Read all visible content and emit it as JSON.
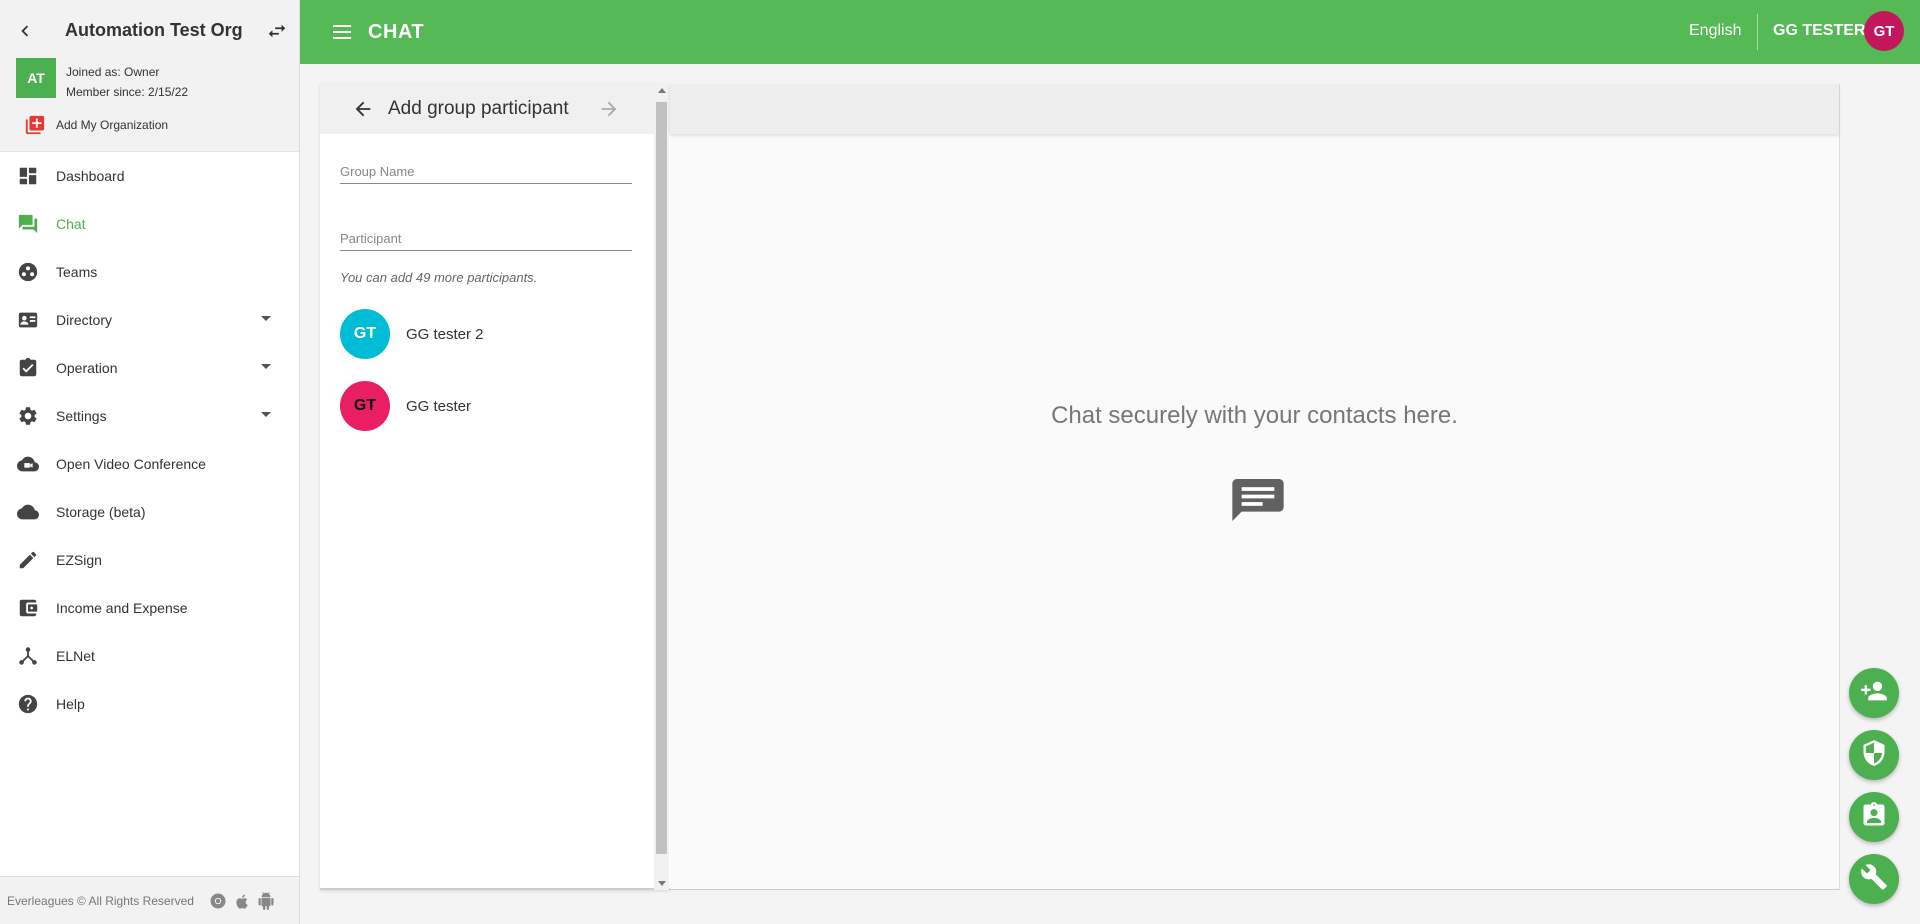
{
  "org": {
    "name": "Automation Test Org",
    "avatar_initials": "AT",
    "joined_as": "Joined as: Owner",
    "member_since": "Member since: 2/15/22",
    "add_org_label": "Add My Organization"
  },
  "nav": {
    "items": [
      {
        "label": "Dashboard",
        "icon": "dashboard-icon"
      },
      {
        "label": "Chat",
        "icon": "chat-icon",
        "active": true
      },
      {
        "label": "Teams",
        "icon": "teams-icon"
      },
      {
        "label": "Directory",
        "icon": "directory-icon",
        "expandable": true
      },
      {
        "label": "Operation",
        "icon": "operation-icon",
        "expandable": true
      },
      {
        "label": "Settings",
        "icon": "gear-icon",
        "expandable": true
      },
      {
        "label": "Open Video Conference",
        "icon": "video-cloud-icon"
      },
      {
        "label": "Storage (beta)",
        "icon": "cloud-icon"
      },
      {
        "label": "EZSign",
        "icon": "pencil-icon"
      },
      {
        "label": "Income and Expense",
        "icon": "wallet-icon"
      },
      {
        "label": "ELNet",
        "icon": "network-icon"
      },
      {
        "label": "Help",
        "icon": "help-icon"
      }
    ]
  },
  "footer": {
    "copyright": "Everleagues © All Rights Reserved"
  },
  "header": {
    "title": "CHAT",
    "language": "English",
    "user_name": "GG TESTER",
    "user_initials": "GT"
  },
  "panel": {
    "title": "Add group participant",
    "group_name_placeholder": "Group Name",
    "participant_placeholder": "Participant",
    "hint": "You can add 49 more participants.",
    "contacts": [
      {
        "initials": "GT",
        "name": "GG tester 2",
        "color": "#00bcd4"
      },
      {
        "initials": "GT",
        "name": "GG tester",
        "color": "#e91e63"
      }
    ]
  },
  "chat": {
    "empty_message": "Chat securely with your contacts here."
  },
  "colors": {
    "brand_green": "#55b955",
    "accent_green": "#4caf50",
    "user_avatar": "#c2185b"
  }
}
